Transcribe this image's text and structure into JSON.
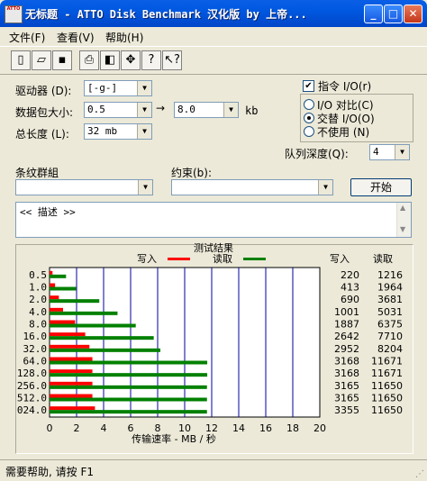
{
  "window": {
    "title": "无标题 - ATTO Disk Benchmark  汉化版 by 上帝...",
    "icon_text": "ATTO"
  },
  "menu": [
    "文件(F)",
    "查看(V)",
    "帮助(H)"
  ],
  "toolbar_icons": [
    "new-icon",
    "open-icon",
    "save-icon",
    "print-icon",
    "print-preview-icon",
    "move-icon",
    "help-icon",
    "context-help-icon"
  ],
  "form": {
    "drive_label": "驱动器 (D):",
    "drive_value": "[-g-]",
    "transfer_label": "数据包大小:",
    "transfer_from": "0.5",
    "transfer_to": "8.0",
    "transfer_unit": "kb",
    "length_label": "总长度 (L):",
    "length_value": "32 mb",
    "io_checkbox_label": "指令 I/O(r)",
    "io_checked": true,
    "radio_compare": "I/O 对比(C)",
    "radio_overlap": "交替 I/O(O)",
    "radio_neither": "不使用 (N)",
    "radio_selected": "overlap",
    "queue_label": "队列深度(Q):",
    "queue_value": "4",
    "stripe_label": "条纹群組",
    "stripe_value": "",
    "constraint_label": "约束(b):",
    "constraint_value": "",
    "start_button": "开始",
    "description": "<< 描述 >>"
  },
  "chart_data": {
    "type": "bar",
    "title": "测试结果",
    "legend": [
      "写入",
      "读取"
    ],
    "legend_colors": [
      "#ff0000",
      "#008000"
    ],
    "xlabel": "传输速率 - MB / 秒",
    "xlim": [
      0,
      20
    ],
    "xticks": [
      "0",
      "2",
      "4",
      "6",
      "8",
      "10",
      "12",
      "14",
      "16",
      "18",
      "20"
    ],
    "categories": [
      "0.5",
      "1.0",
      "2.0",
      "4.0",
      "8.0",
      "16.0",
      "32.0",
      "64.0",
      "128.0",
      "256.0",
      "512.0",
      "024.0"
    ],
    "series": [
      {
        "name": "写入",
        "values": [
          0.22,
          0.41,
          0.69,
          1.0,
          1.89,
          2.64,
          2.95,
          3.17,
          3.17,
          3.17,
          3.17,
          3.36
        ]
      },
      {
        "name": "读取",
        "values": [
          1.22,
          1.96,
          3.68,
          5.03,
          6.38,
          7.71,
          8.2,
          11.67,
          11.67,
          11.65,
          11.65,
          11.65
        ]
      }
    ],
    "table_header": [
      "写入",
      "读取"
    ],
    "table_write": [
      "220",
      "413",
      "690",
      "1001",
      "1887",
      "2642",
      "2952",
      "3168",
      "3168",
      "3165",
      "3165",
      "3355"
    ],
    "table_read": [
      "1216",
      "1964",
      "3681",
      "5031",
      "6375",
      "7710",
      "8204",
      "11671",
      "11671",
      "11650",
      "11650",
      "11650"
    ]
  },
  "status": "需要帮助, 请按 F1"
}
